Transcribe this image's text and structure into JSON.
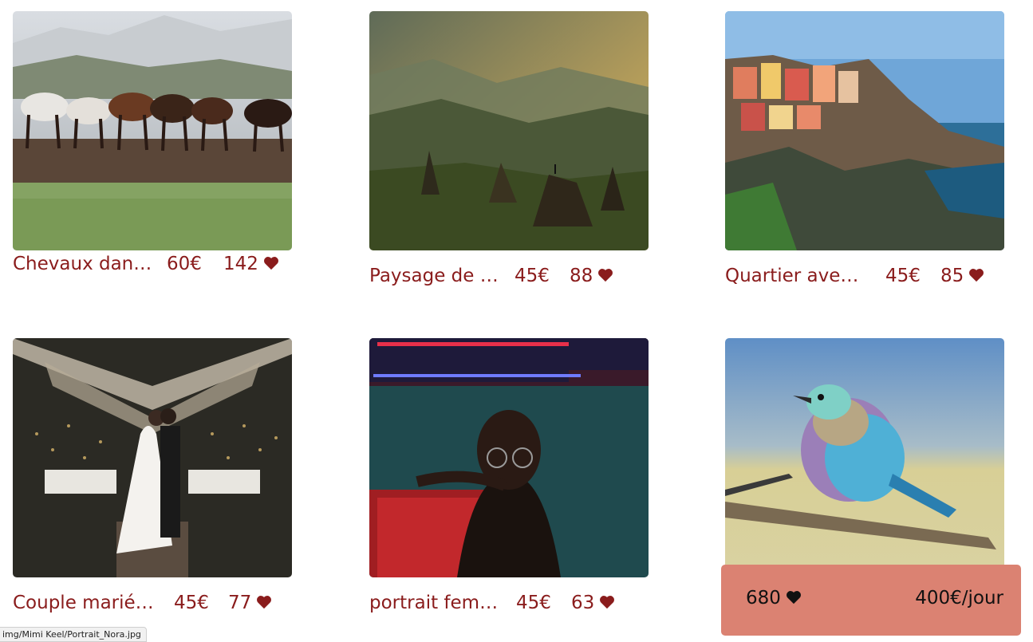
{
  "gallery": {
    "items": [
      {
        "title": "Chevaux dans ...",
        "price": "60€",
        "likes": "142",
        "icon": "heart-icon"
      },
      {
        "title": "Paysage de m...",
        "price": "45€",
        "likes": "88",
        "icon": "heart-icon"
      },
      {
        "title": "Quartier avec ...",
        "price": "45€",
        "likes": "85",
        "icon": "heart-icon"
      },
      {
        "title": "Couple mariés ...",
        "price": "45€",
        "likes": "77",
        "icon": "heart-icon"
      },
      {
        "title": "portrait femm...",
        "price": "45€",
        "likes": "63",
        "icon": "heart-icon"
      }
    ]
  },
  "summary": {
    "total_likes": "680",
    "rate": "400€/jour",
    "icon": "heart-icon"
  },
  "status_bar": {
    "url": "img/Mimi Keel/Portrait_Nora.jpg"
  },
  "colors": {
    "accent_text": "#8a1c1c",
    "summary_bg": "#db8272"
  }
}
